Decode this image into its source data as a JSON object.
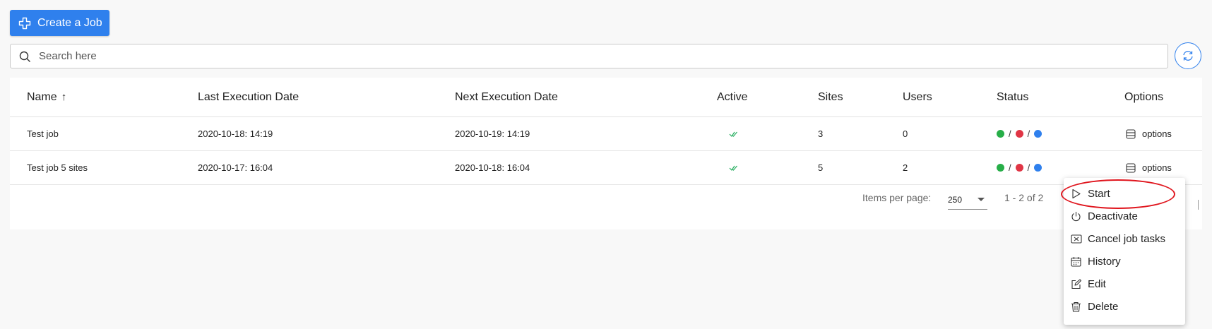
{
  "toolbar": {
    "create_label": "Create a Job"
  },
  "search": {
    "placeholder": "Search here"
  },
  "table": {
    "headers": {
      "name": "Name",
      "last_exec": "Last Execution Date",
      "next_exec": "Next Execution Date",
      "active": "Active",
      "sites": "Sites",
      "users": "Users",
      "status": "Status",
      "options": "Options"
    },
    "sort_indicator": "↑",
    "rows": [
      {
        "name": "Test job",
        "last_exec": "2020-10-18: 14:19",
        "next_exec": "2020-10-19: 14:19",
        "active": true,
        "sites": "3",
        "users": "0",
        "options_label": "options"
      },
      {
        "name": "Test job 5 sites",
        "last_exec": "2020-10-17: 16:04",
        "next_exec": "2020-10-18: 16:04",
        "active": true,
        "sites": "5",
        "users": "2",
        "options_label": "options"
      }
    ],
    "status_separator": "/"
  },
  "pagination": {
    "items_label": "Items per page:",
    "items_value": "250",
    "range": "1 - 2 of 2"
  },
  "menu": {
    "items": [
      "Start",
      "Deactivate",
      "Cancel job tasks",
      "History",
      "Edit",
      "Delete"
    ]
  },
  "colors": {
    "primary": "#2f80ed",
    "status_green": "#27ae48",
    "status_red": "#e03545",
    "status_blue": "#2f80ed",
    "check_green": "#27ae60",
    "highlight": "#e0161e"
  }
}
